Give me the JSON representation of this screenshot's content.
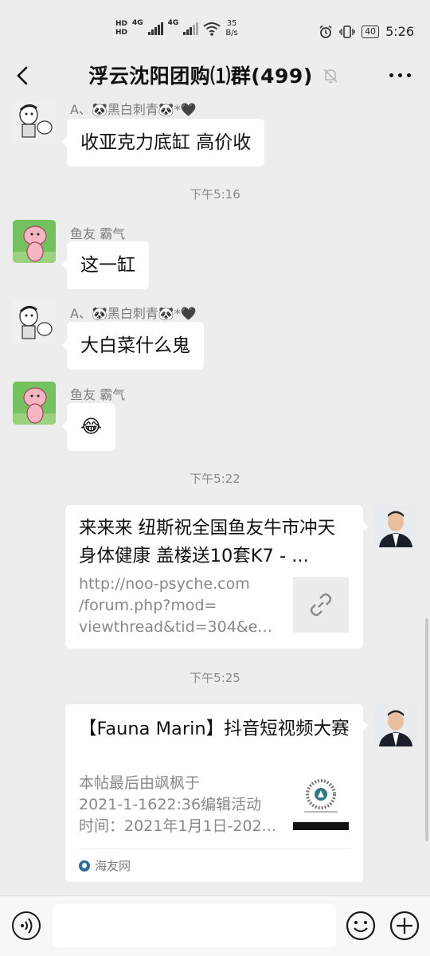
{
  "status_bar": {
    "hd1": "HD",
    "hd2": "HD",
    "network1": "4G",
    "network2": "4G",
    "speed_value": "35",
    "speed_unit": "B/s",
    "battery": "40",
    "time": "5:26"
  },
  "header": {
    "title": "浮云沈阳团购⑴群(499)"
  },
  "messages": [
    {
      "sender": "A、🐼黑白刺青🐼*🖤",
      "text": "收亚克力底缸 高价收"
    },
    {
      "sender": "鱼友 霸气",
      "text": "这一缸"
    },
    {
      "sender": "A、🐼黑白刺青🐼*🖤",
      "text": "大白菜什么鬼"
    },
    {
      "sender": "鱼友 霸气",
      "text": "😂"
    }
  ],
  "timestamps": [
    "下午5:16",
    "下午5:22",
    "下午5:25"
  ],
  "link_card": {
    "title": "来来来 纽斯祝全国鱼友牛市冲天 身体健康 盖楼送10套K7 - ...",
    "desc_lines": [
      "http://noo-psyche.com",
      "/forum.php?mod=",
      "viewthread&tid=304&extr..."
    ],
    "thumb_icon": "link-icon"
  },
  "article_card": {
    "title": "【Fauna Marin】抖音短视频大赛",
    "desc_lines": [
      "本帖最后由飒枫于",
      "2021-1-1622:36编辑活动",
      "时间：2021年1月1日-202..."
    ],
    "source": "海友网",
    "thumb_icon": "qr-code-thumbnail"
  },
  "input": {
    "placeholder": ""
  },
  "colors": {
    "background": "#ededed",
    "bubble": "#ffffff",
    "meta_text": "#8a8a8a"
  }
}
